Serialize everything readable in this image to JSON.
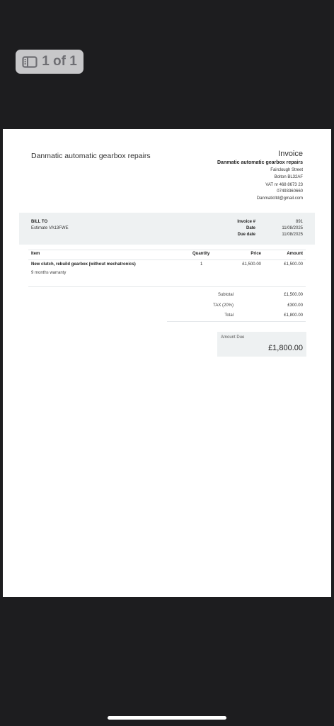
{
  "viewer": {
    "page_indicator": "1 of 1"
  },
  "invoice": {
    "company_left": "Danmatic automatic gearbox repairs",
    "title": "Invoice",
    "company_name": "Danmatic automatic gearbox repairs",
    "address_lines": [
      "Fairclough Street",
      "Bolton BL32AF"
    ],
    "vat": "VAT nr 468 8673 23",
    "phone": "07493360660",
    "email": "Danmaticltd@gmail.com",
    "bill_to_label": "BILL TO",
    "bill_to_value": "Estimate VA13FWE",
    "meta": [
      {
        "label": "Invoice #",
        "value": "891"
      },
      {
        "label": "Date",
        "value": "11/08/2025"
      },
      {
        "label": "Due date",
        "value": "11/08/2025"
      }
    ],
    "columns": {
      "item": "Item",
      "quantity": "Quantity",
      "price": "Price",
      "amount": "Amount"
    },
    "items": [
      {
        "name": "New clutch, rebuild gearbox (without mechatronics)",
        "description": "9 months warranty",
        "quantity": "1",
        "price": "£1,500.00",
        "amount": "£1,500.00"
      }
    ],
    "totals": [
      {
        "label": "Subtotal",
        "value": "£1,500.00"
      },
      {
        "label": "TAX (20%)",
        "value": "£300.00"
      },
      {
        "label": "Total",
        "value": "£1,800.00"
      }
    ],
    "amount_due_label": "Amount Due",
    "amount_due": "£1,800.00"
  }
}
